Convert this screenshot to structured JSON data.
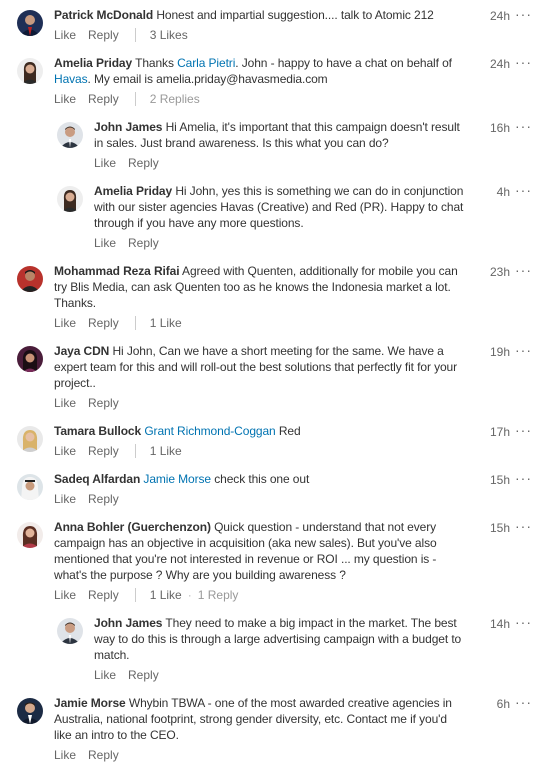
{
  "comments": [
    {
      "name": "Patrick McDonald",
      "text": "Honest and impartial suggestion.... talk to Atomic 212",
      "time": "24h",
      "like": "Like",
      "reply": "Reply",
      "likes": "3 Likes"
    },
    {
      "name": "Amelia Priday",
      "text_1": "Thanks ",
      "mention_1": "Carla Pietri",
      "text_2": ". John - happy to have a chat on behalf of ",
      "mention_2": "Havas",
      "text_3": ". My email is amelia.priday@havasmedia.com",
      "time": "24h",
      "like": "Like",
      "reply": "Reply",
      "replies": "2 Replies"
    },
    {
      "name": "John James",
      "text": "Hi Amelia, it's important that this campaign doesn't result in sales. Just brand awareness. Is this what you can do?",
      "time": "16h",
      "like": "Like",
      "reply": "Reply"
    },
    {
      "name": "Amelia Priday",
      "text": "Hi John, yes this is something we can do in conjunction with our sister agencies Havas (Creative) and Red (PR). Happy to chat through if you have any more questions.",
      "time": "4h",
      "like": "Like",
      "reply": "Reply"
    },
    {
      "name": "Mohammad Reza Rifai",
      "text": "Agreed with Quenten, additionally for mobile you can try Blis Media, can ask Quenten too as he knows the Indonesia market a lot. Thanks.",
      "time": "23h",
      "like": "Like",
      "reply": "Reply",
      "likes": "1 Like"
    },
    {
      "name": "Jaya CDN",
      "text": "Hi John, Can we have a short meeting for the same. We have a expert team for this and will roll-out the best solutions that perfectly fit for your project..",
      "time": "19h",
      "like": "Like",
      "reply": "Reply"
    },
    {
      "name": "Tamara Bullock",
      "mention": "Grant Richmond-Coggan",
      "text": " Red",
      "time": "17h",
      "like": "Like",
      "reply": "Reply",
      "likes": "1 Like"
    },
    {
      "name": "Sadeq Alfardan",
      "mention": "Jamie Morse",
      "text": " check this one out",
      "time": "15h",
      "like": "Like",
      "reply": "Reply"
    },
    {
      "name": "Anna Bohler (Guerchenzon)",
      "text": "Quick question - understand that not every campaign has an objective in acquisition (aka new sales). But you've also mentioned that you're not interested in revenue or ROI ... my question is - what's the purpose ? Why are you building awareness ?",
      "time": "15h",
      "like": "Like",
      "reply": "Reply",
      "likes": "1 Like",
      "dot": "·",
      "replies": "1 Reply"
    },
    {
      "name": "John James",
      "text": "They need to make a big impact in the market. The best way to do this is through a large advertising campaign with a budget to match.",
      "time": "14h",
      "like": "Like",
      "reply": "Reply"
    },
    {
      "name": "Jamie Morse",
      "text": "Whybin TBWA - one of the most awarded creative agencies in Australia, national footprint, strong gender diversity, etc. Contact me if you'd like an intro to the CEO.",
      "time": "6h",
      "like": "Like",
      "reply": "Reply"
    }
  ],
  "more_icon": "···",
  "icons": {
    "more": "ellipsis-icon",
    "avatar": "user-avatar"
  },
  "colors": {
    "link": "#0073b1",
    "meta": "#666666",
    "text": "#333333"
  }
}
